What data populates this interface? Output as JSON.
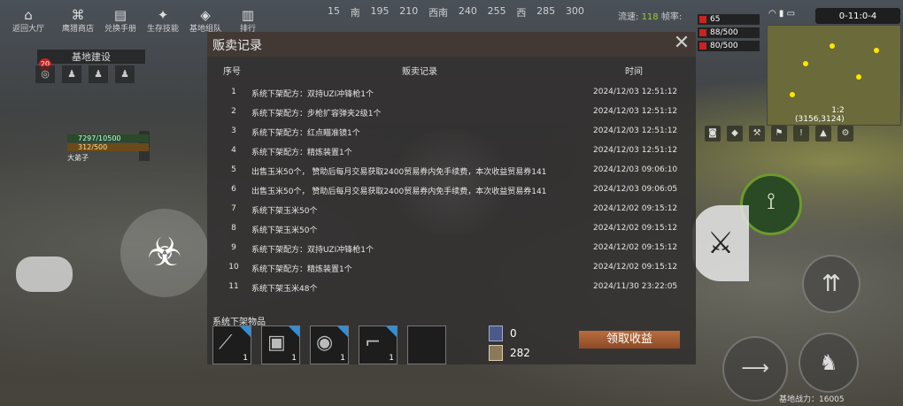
{
  "topnav": [
    {
      "label": "返回大厅",
      "icon": "home-icon",
      "glyph": "⌂"
    },
    {
      "label": "鹰猎商店",
      "icon": "shop-icon",
      "glyph": "⌘"
    },
    {
      "label": "兑换手册",
      "icon": "handbook-icon",
      "glyph": "▤"
    },
    {
      "label": "生存技能",
      "icon": "skill-icon",
      "glyph": "✦"
    },
    {
      "label": "基地组队",
      "icon": "team-icon",
      "glyph": "◈"
    },
    {
      "label": "排行",
      "icon": "rank-icon",
      "glyph": "▥"
    }
  ],
  "compass": [
    "15",
    "南",
    "195",
    "210",
    "西南",
    "240",
    "255",
    "西",
    "285",
    "300"
  ],
  "status": {
    "speed_label": "流速:",
    "speed_value": "118",
    "fps_label": "帧率:"
  },
  "hp_bars": [
    "65",
    "88/500",
    "80/500"
  ],
  "clock": "0-11:0-4",
  "minimap_coord": {
    "line1": "1:2",
    "line2": "(3156,3124)"
  },
  "hud_left": {
    "base_title": "基地建设",
    "badge": "20",
    "hp": "7297/10500",
    "stamina": "312/500",
    "player_name": "大弟子"
  },
  "power": "基地战力：16005",
  "dialog": {
    "title": "贩卖记录",
    "close": "✕",
    "headers": {
      "no": "序号",
      "record": "贩卖记录",
      "time": "时间"
    },
    "rows": [
      {
        "no": "1",
        "record": "系统下架配方：双持UZI冲锋枪1个",
        "time": "2024/12/03 12:51:12"
      },
      {
        "no": "2",
        "record": "系统下架配方：步枪扩容弹夹2级1个",
        "time": "2024/12/03 12:51:12"
      },
      {
        "no": "3",
        "record": "系统下架配方：红点瞄准镜1个",
        "time": "2024/12/03 12:51:12"
      },
      {
        "no": "4",
        "record": "系统下架配方：精炼装置1个",
        "time": "2024/12/03 12:51:12"
      },
      {
        "no": "5",
        "record": "出售玉米50个， 赞助后每月交易获取2400贸易券内免手续费，本次收益贸易券141",
        "time": "2024/12/03 09:06:10"
      },
      {
        "no": "6",
        "record": "出售玉米50个， 赞助后每月交易获取2400贸易券内免手续费，本次收益贸易券141",
        "time": "2024/12/03 09:06:05"
      },
      {
        "no": "7",
        "record": "系统下架玉米50个",
        "time": "2024/12/02 09:15:12"
      },
      {
        "no": "8",
        "record": "系统下架玉米50个",
        "time": "2024/12/02 09:15:12"
      },
      {
        "no": "9",
        "record": "系统下架配方：双持UZI冲锋枪1个",
        "time": "2024/12/02 09:15:12"
      },
      {
        "no": "10",
        "record": "系统下架配方：精炼装置1个",
        "time": "2024/12/02 09:15:12"
      },
      {
        "no": "11",
        "record": "系统下架玉米48个",
        "time": "2024/11/30 23:22:05"
      }
    ],
    "footer_label": "系统下架物品",
    "slots": [
      {
        "icon": "machete-icon",
        "glyph": "⟋",
        "qty": "1",
        "tag": true
      },
      {
        "icon": "furnace-icon",
        "glyph": "▣",
        "qty": "1",
        "tag": true
      },
      {
        "icon": "scope-icon",
        "glyph": "◉",
        "qty": "1",
        "tag": true
      },
      {
        "icon": "uzi-icon",
        "glyph": "⌐",
        "qty": "1",
        "tag": true
      },
      {
        "icon": "empty-slot",
        "glyph": "",
        "qty": "",
        "tag": false
      }
    ],
    "currency": [
      {
        "icon": "ticket-icon",
        "value": "0"
      },
      {
        "icon": "coin-card-icon",
        "value": "282"
      }
    ],
    "claim_button": "领取收益"
  }
}
